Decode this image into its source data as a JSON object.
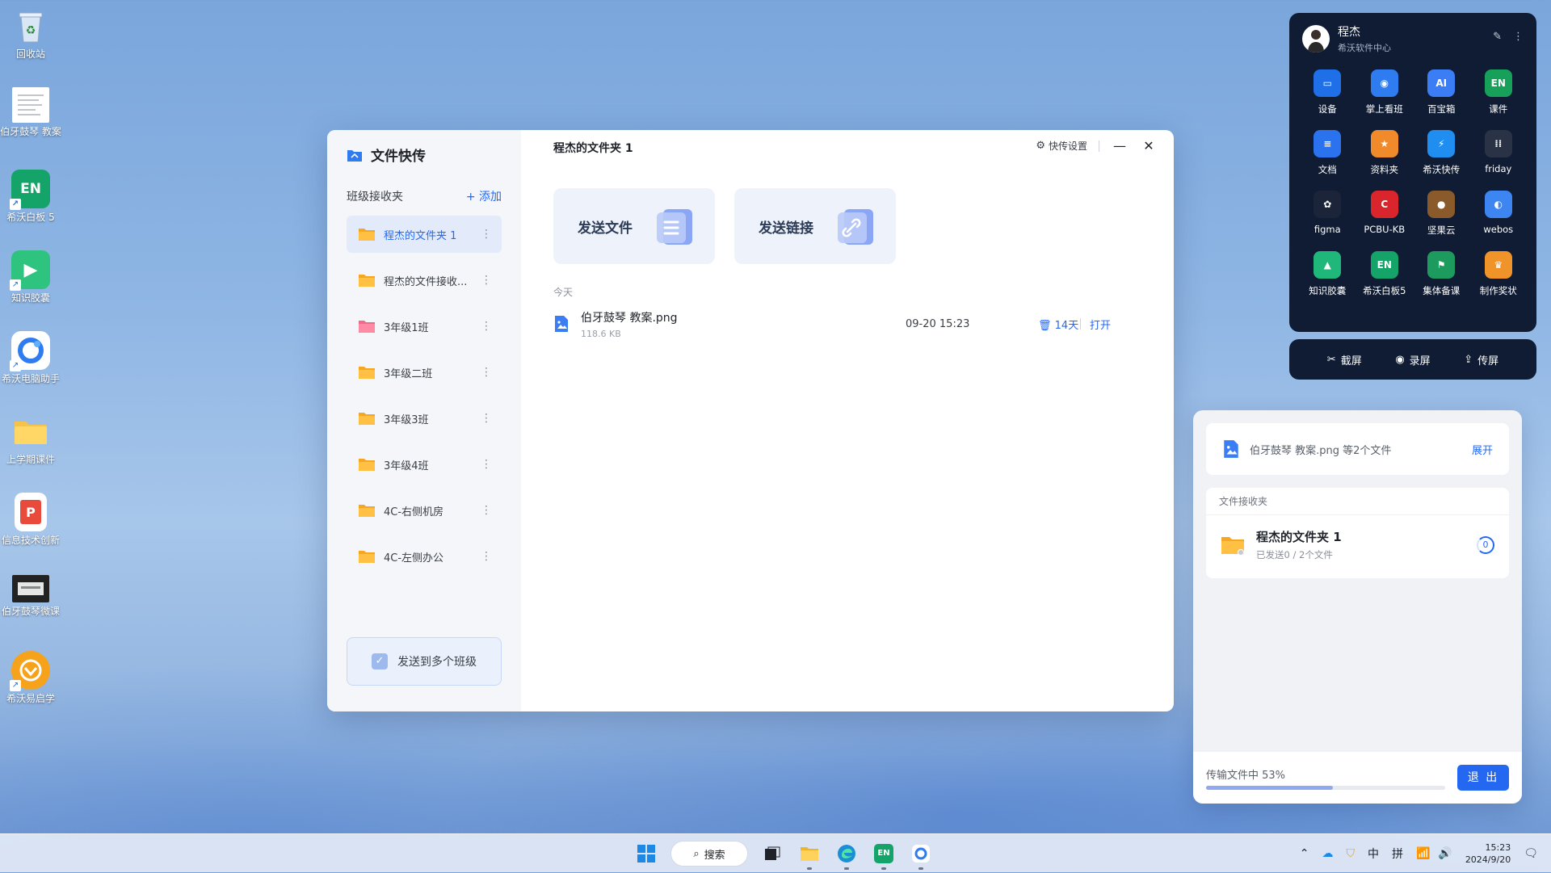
{
  "desktop": {
    "icons": [
      {
        "label": "回收站"
      },
      {
        "label": "伯牙鼓琴 教案"
      },
      {
        "label": "希沃白板 5"
      },
      {
        "label": "知识胶囊"
      },
      {
        "label": "希沃电脑助手"
      },
      {
        "label": "上学期课件"
      },
      {
        "label": "信息技术创新"
      },
      {
        "label": "伯牙鼓琴微课"
      },
      {
        "label": "希沃易启学"
      }
    ]
  },
  "window": {
    "app_title": "文件快传",
    "section_title": "班级接收夹",
    "add_label": "+ 添加",
    "folders": [
      {
        "name": "程杰的文件夹 1",
        "active": true
      },
      {
        "name": "程杰的文件接收..."
      },
      {
        "name": "3年级1班"
      },
      {
        "name": "3年级二班"
      },
      {
        "name": "3年级3班"
      },
      {
        "name": "3年级4班"
      },
      {
        "name": "4C-右侧机房"
      },
      {
        "name": "4C-左侧办公"
      }
    ],
    "send_multi_label": "发送到多个班级",
    "main_title": "程杰的文件夹 1",
    "settings_label": "快传设置",
    "send_file_label": "发送文件",
    "send_link_label": "发送链接",
    "group_label": "今天",
    "file": {
      "name": "伯牙鼓琴 教案.png",
      "size": "118.6 KB",
      "time": "09-20 15:23",
      "keep": "14天",
      "open": "打开"
    }
  },
  "quick_panel": {
    "user_name": "程杰",
    "org": "希沃软件中心",
    "apps": [
      {
        "label": "设备",
        "color": "#1e6fe8",
        "glyph": "▭"
      },
      {
        "label": "掌上看班",
        "color": "#2f7bf0",
        "glyph": "◉"
      },
      {
        "label": "百宝箱",
        "color": "#3a7df5",
        "glyph": "AI"
      },
      {
        "label": "课件",
        "color": "#17a05a",
        "glyph": "EN"
      },
      {
        "label": "文档",
        "color": "#2b72ee",
        "glyph": "≡"
      },
      {
        "label": "资料夹",
        "color": "#f08a2a",
        "glyph": "★"
      },
      {
        "label": "希沃快传",
        "color": "#1f8ef0",
        "glyph": "⚡"
      },
      {
        "label": "friday",
        "color": "#2a3346",
        "glyph": "⁞⁞"
      },
      {
        "label": "figma",
        "color": "#1b2438",
        "glyph": "✿"
      },
      {
        "label": "PCBU-KB",
        "color": "#d9252b",
        "glyph": "C"
      },
      {
        "label": "坚果云",
        "color": "#8a5a2b",
        "glyph": "●"
      },
      {
        "label": "webos",
        "color": "#3d86f2",
        "glyph": "◐"
      },
      {
        "label": "知识胶囊",
        "color": "#1fb87a",
        "glyph": "▲"
      },
      {
        "label": "希沃白板5",
        "color": "#14a368",
        "glyph": "EN"
      },
      {
        "label": "集体备课",
        "color": "#1d9b5f",
        "glyph": "⚑"
      },
      {
        "label": "制作奖状",
        "color": "#f0942a",
        "glyph": "♛"
      }
    ],
    "bar": [
      {
        "label": "截屏",
        "glyph": "✂"
      },
      {
        "label": "录屏",
        "glyph": "◉"
      },
      {
        "label": "传屏",
        "glyph": "⇪"
      }
    ]
  },
  "transfer": {
    "summary": "伯牙鼓琴 教案.png 等2个文件",
    "expand_label": "展开",
    "box_header": "文件接收夹",
    "folder_name": "程杰的文件夹 1",
    "folder_status": "已发送0 / 2个文件",
    "ring_value": "0",
    "status_text": "传输文件中 53%",
    "progress": 53,
    "exit_label": "退 出"
  },
  "taskbar": {
    "search_label": "搜索",
    "ime_lang": "中",
    "ime_mode": "拼",
    "time": "15:23",
    "date": "2024/9/20"
  }
}
